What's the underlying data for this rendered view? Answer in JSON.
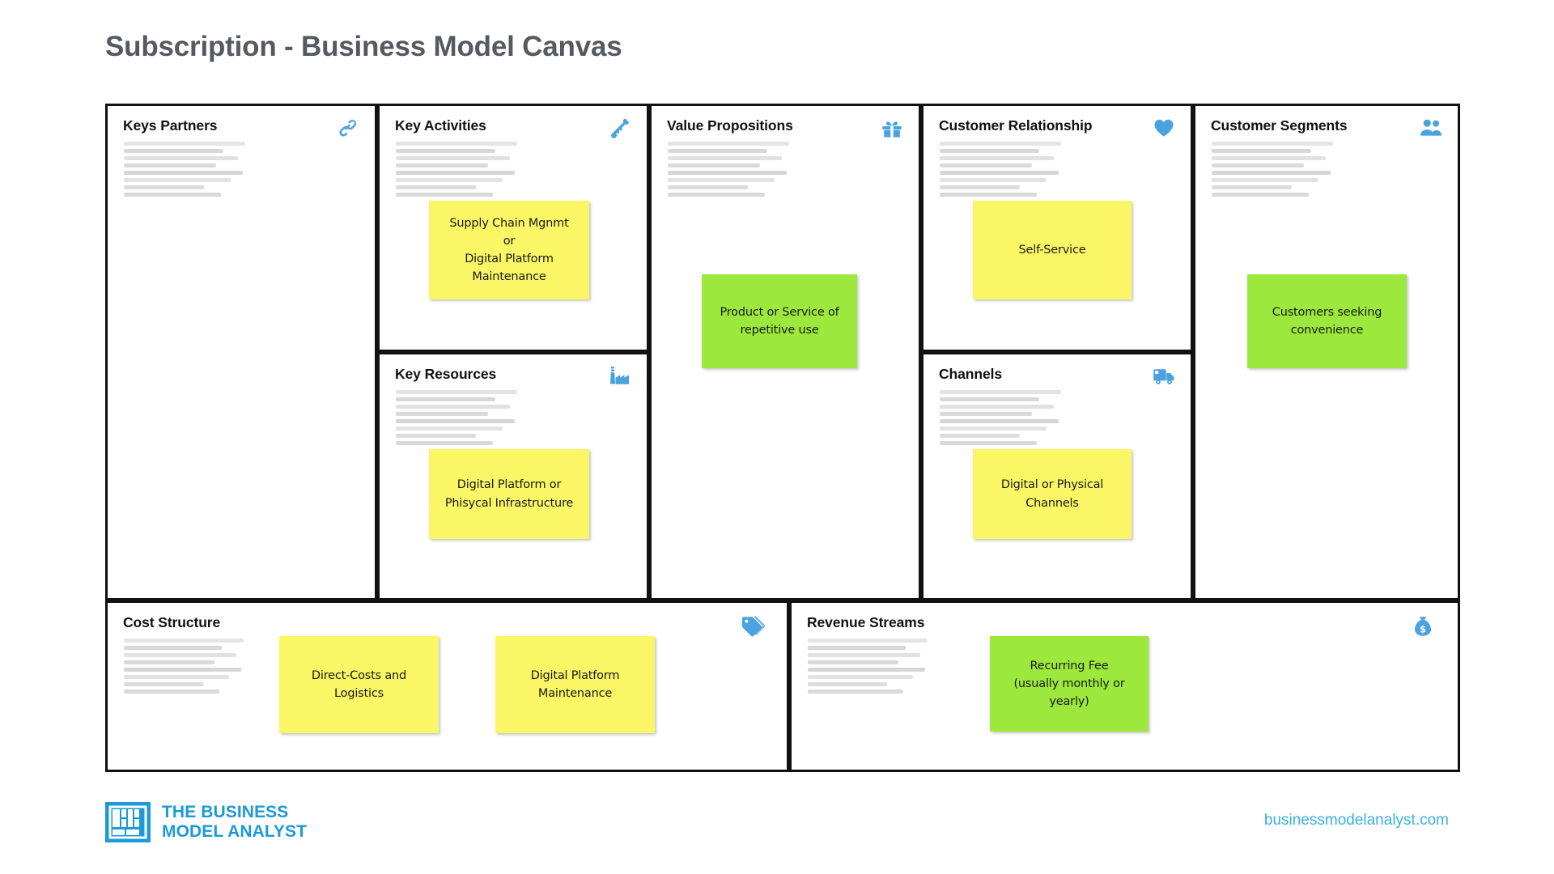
{
  "page": {
    "title": "Subscription - Business Model Canvas",
    "accent_blue": "#4aa3df",
    "note_yellow": "#fbf665",
    "note_green": "#9ce83c",
    "border_color": "#111111",
    "title_color": "#545a60"
  },
  "blocks": {
    "key_partners": {
      "title": "Keys Partners",
      "icon": "chain-link-icon"
    },
    "key_activities": {
      "title": "Key Activities",
      "icon": "shovel-icon"
    },
    "key_resources": {
      "title": "Key Resources",
      "icon": "factory-icon"
    },
    "value_propositions": {
      "title": "Value Propositions",
      "icon": "gift-icon"
    },
    "customer_relationship": {
      "title": "Customer Relationship",
      "icon": "heart-icon"
    },
    "channels": {
      "title": "Channels",
      "icon": "delivery-truck-icon"
    },
    "customer_segments": {
      "title": "Customer Segments",
      "icon": "users-icon"
    },
    "cost_structure": {
      "title": "Cost Structure",
      "icon": "price-tag-icon"
    },
    "revenue_streams": {
      "title": "Revenue Streams",
      "icon": "money-bag-icon"
    }
  },
  "notes": {
    "key_activities": {
      "text": "Supply Chain Mgnmt\nor\nDigital Platform\nMaintenance",
      "color": "yellow"
    },
    "key_resources": {
      "text": "Digital Platform or\nPhisycal Infrastructure",
      "color": "yellow"
    },
    "value_propositions": {
      "text": "Product or Service of\nrepetitive use",
      "color": "green"
    },
    "customer_relationship": {
      "text": "Self-Service",
      "color": "yellow"
    },
    "channels": {
      "text": "Digital or Physical\nChannels",
      "color": "yellow"
    },
    "customer_segments": {
      "text": "Customers seeking\nconvenience",
      "color": "green"
    },
    "cost_1": {
      "text": "Direct-Costs and Logistics",
      "color": "yellow"
    },
    "cost_2": {
      "text": "Digital Platform\nMaintenance",
      "color": "yellow"
    },
    "revenue_1": {
      "text": "Recurring Fee\n(usually monthly or yearly)",
      "color": "green"
    }
  },
  "footer": {
    "logo_line1": "THE BUSINESS",
    "logo_line2": "MODEL ANALYST",
    "url": "businessmodelanalyst.com"
  }
}
